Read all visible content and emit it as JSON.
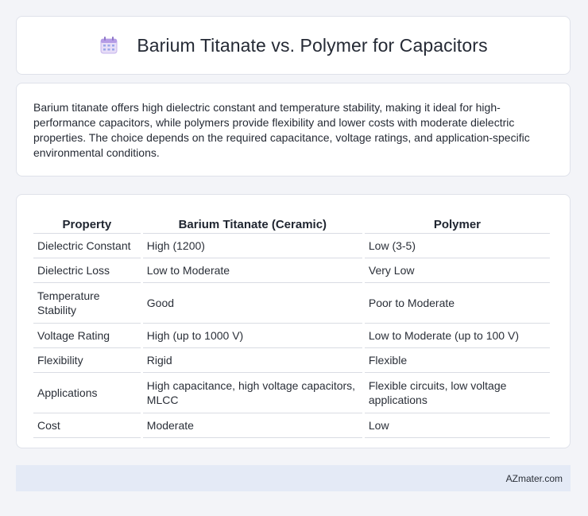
{
  "header": {
    "icon": "calendar-icon",
    "title": "Barium Titanate vs. Polymer for Capacitors"
  },
  "summary": {
    "text": "Barium titanate offers high dielectric constant and temperature stability, making it ideal for high-performance capacitors, while polymers provide flexibility and lower costs with moderate dielectric properties. The choice depends on the required capacitance, voltage ratings, and application-specific environmental conditions."
  },
  "table": {
    "headers": [
      "Property",
      "Barium Titanate (Ceramic)",
      "Polymer"
    ],
    "rows": [
      [
        "Dielectric Constant",
        "High (1200)",
        "Low (3-5)"
      ],
      [
        "Dielectric Loss",
        "Low to Moderate",
        "Very Low"
      ],
      [
        "Temperature Stability",
        "Good",
        "Poor to Moderate"
      ],
      [
        "Voltage Rating",
        "High (up to 1000 V)",
        "Low to Moderate (up to 100 V)"
      ],
      [
        "Flexibility",
        "Rigid",
        "Flexible"
      ],
      [
        "Applications",
        "High capacitance, high voltage capacitors, MLCC",
        "Flexible circuits, low voltage applications"
      ],
      [
        "Cost",
        "Moderate",
        "Low"
      ]
    ]
  },
  "footer": {
    "brand": "AZmater.com"
  }
}
